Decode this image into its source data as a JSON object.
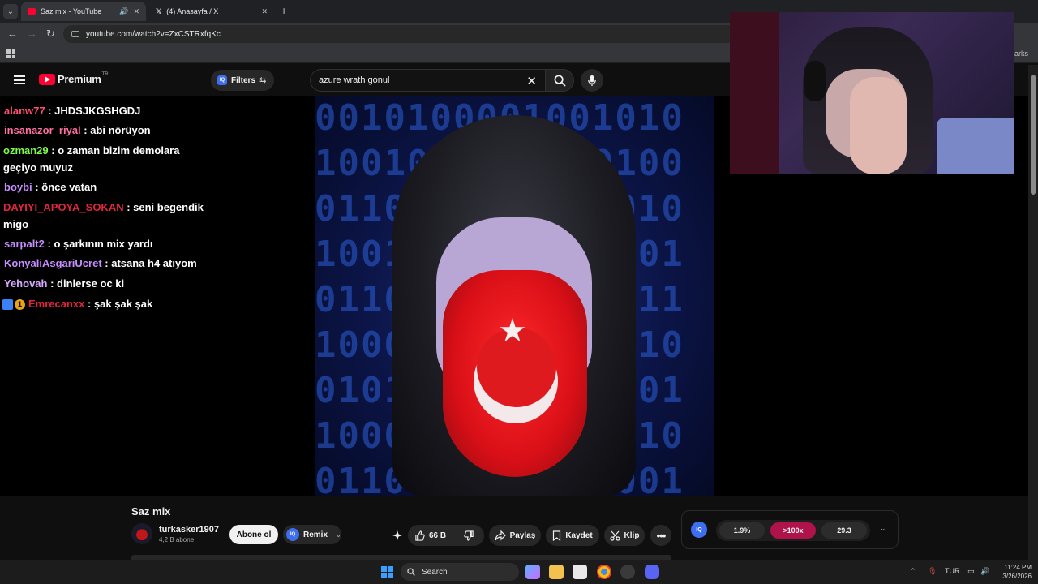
{
  "browser": {
    "tabs": [
      {
        "title": "Saz mix - YouTube",
        "active": true
      },
      {
        "title": "(4) Anasayfa / X",
        "active": false
      }
    ],
    "url": "youtube.com/watch?v=ZxCSTRxfqKc",
    "bookmarks_right": "marks"
  },
  "youtube": {
    "logo_text": "Premium",
    "country_code": "TR",
    "filters_label": "Filters",
    "search_value": "azure wrath gonul"
  },
  "chat": [
    {
      "user": "alanw77",
      "color": "#ff4d6d",
      "text": ": JHDSJKGSHGDJ"
    },
    {
      "user": "insanazor_riyal",
      "color": "#ff6fa1",
      "text": ": abi nörüyon"
    },
    {
      "user": "ozman29",
      "color": "#7cfc4a",
      "text": ": o zaman bizim demolara geçiyo muyuz"
    },
    {
      "user": "boybi",
      "color": "#c78cff",
      "text": ": önce vatan"
    },
    {
      "user": "DAYIYI_APOYA_SOKAN",
      "color": "#e0253f",
      "text": ": seni begendik migo"
    },
    {
      "user": "sarpalt2",
      "color": "#c78cff",
      "text": ": o şarkının mix yardı"
    },
    {
      "user": "KonyaliAsgariUcret",
      "color": "#c78cff",
      "text": ": atsana h4 atıyom"
    },
    {
      "user": "Yehovah",
      "color": "#d8a8ff",
      "text": ": dinlerse oc ki"
    },
    {
      "user": "Emrecanxx",
      "color": "#e0253f",
      "text": ": şak şak şak"
    }
  ],
  "video": {
    "binary_rows": [
      "0010100001001010",
      "1001001100100100",
      "0110011001001010",
      "1001011000110101",
      "0110101001001011",
      "1000101101001010",
      "0101101001101001",
      "1000100101001010",
      "0110101001101001"
    ]
  },
  "info": {
    "title": "Saz mix",
    "channel_name": "turkasker1907",
    "subscribers": "4,2 B abone",
    "subscribe_label": "Abone ol",
    "remix_label": "Remix",
    "likes": "66 B",
    "share_label": "Paylaş",
    "save_label": "Kaydet",
    "clip_label": "Klip",
    "stats": [
      "1.9%",
      ">100x",
      "29.3"
    ]
  },
  "taskbar": {
    "search_label": "Search",
    "language": "TUR",
    "time": "11:24 PM",
    "date": "3/26/2026"
  }
}
